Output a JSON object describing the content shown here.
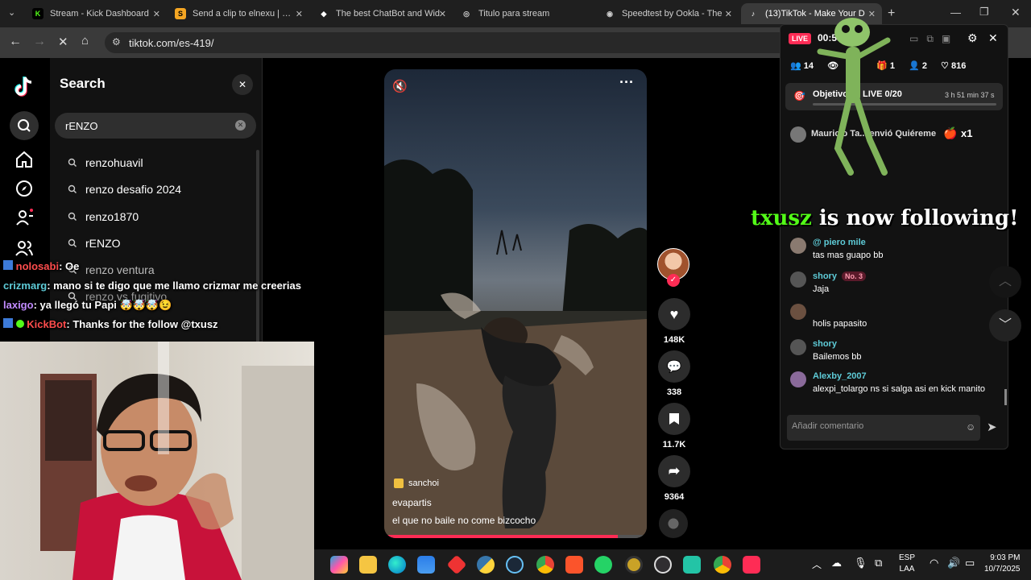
{
  "tabs": [
    {
      "title": "Stream - Kick Dashboard",
      "color": "#53fc18",
      "glyph": "K"
    },
    {
      "title": "Send a clip to elnexu | Don",
      "color": "#f5a623",
      "glyph": "S"
    },
    {
      "title": "The best ChatBot and Wid",
      "color": "#ffffff",
      "glyph": "◆"
    },
    {
      "title": "Titulo para stream",
      "color": "#cfcfcf",
      "glyph": "◎"
    },
    {
      "title": "Speedtest by Ookla - The",
      "color": "#cfcfcf",
      "glyph": "◉"
    },
    {
      "title": "(13)TikTok - Make Your D",
      "color": "#ff2e63",
      "glyph": "♪"
    }
  ],
  "address": {
    "url": "tiktok.com/es-419/"
  },
  "search": {
    "title": "Search",
    "query": "rENZO",
    "suggestions": [
      "renzohuavil",
      "renzo desafio 2024",
      "renzo1870",
      "rENZO",
      "renzo ventura",
      "renzo vs fugitivo"
    ]
  },
  "video": {
    "author": "evapartis",
    "caption": "el que no baile no come bizcocho",
    "sound": "sanchoi",
    "likes": "148K",
    "comments": "338",
    "saves": "11.7K",
    "shares": "9364"
  },
  "live": {
    "badge": "LIVE",
    "timer": "00:58",
    "viewers": "14",
    "gifts": "1",
    "follows": "2",
    "likes": "816",
    "goal_label": "Objetivo",
    "goal_text": "LIVE 0/20",
    "goal_time": "3 h 51 min 37 s",
    "gift_line": "Mauricio Ta... envió Quiéreme",
    "gift_count": "x1",
    "follow_alert_user": "txusz",
    "follow_alert_text": "is now following!",
    "comments": [
      {
        "name": "@ piero mile",
        "text": "tas mas guapo bb"
      },
      {
        "name": "shory",
        "badge": "No. 3",
        "text": "Jaja"
      },
      {
        "name": "",
        "text": "holis papasito"
      },
      {
        "name": "shory",
        "text": "Bailemos bb"
      },
      {
        "name": "Alexby_2007",
        "text": "alexpi_tolargo ns si salga asi en kick manito"
      }
    ],
    "input_placeholder": "Añadir comentario"
  },
  "stream_chat": [
    {
      "user": "nolosabi",
      "user_color": "#ff4d4d",
      "text": ": Oe"
    },
    {
      "user": "crizmarg",
      "user_color": "#5ecbd7",
      "text": ": mano si te digo que me llamo crizmar me creerias"
    },
    {
      "user": "laxigo",
      "user_color": "#c18bff",
      "text": ": ya llegó tu Papi 🤯🤯🤯😉"
    },
    {
      "user": "KickBot",
      "user_color": "#ff4d4d",
      "text": ": Thanks for the follow @txusz"
    }
  ],
  "tray": {
    "lang": "ESP",
    "layout": "LAA",
    "time": "9:03 PM",
    "date": "10/7/2025"
  }
}
